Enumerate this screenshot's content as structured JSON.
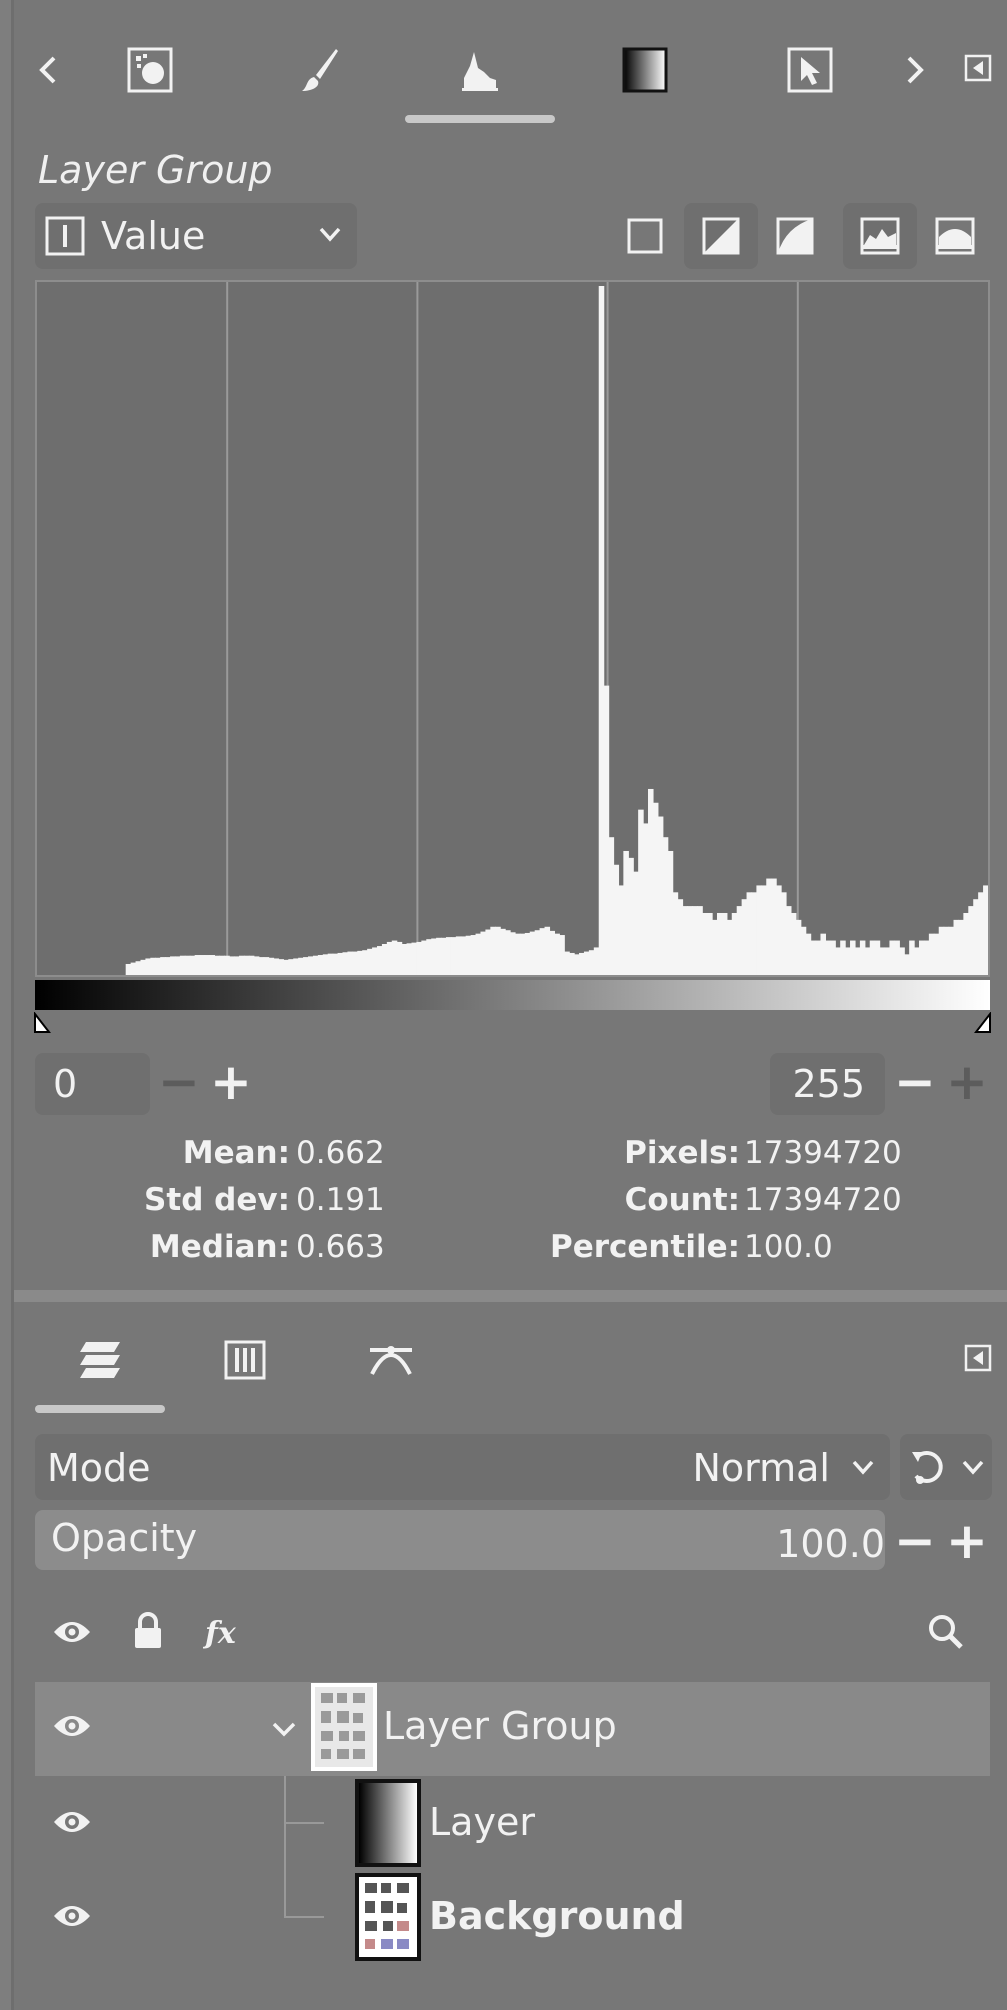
{
  "histogram_panel": {
    "title": "Layer Group",
    "channel": "Value",
    "range_low": "0",
    "range_high": "255",
    "minus": "−",
    "plus": "+",
    "stats": {
      "mean_label": "Mean:",
      "mean_value": "0.662",
      "stddev_label": "Std dev:",
      "stddev_value": "0.191",
      "median_label": "Median:",
      "median_value": "0.663",
      "pixels_label": "Pixels:",
      "pixels_value": "17394720",
      "count_label": "Count:",
      "count_value": "17394720",
      "percentile_label": "Percentile:",
      "percentile_value": "100.0"
    },
    "histogram_bins": [
      0,
      0,
      0,
      0,
      0,
      0,
      0,
      0,
      0,
      0,
      0,
      0,
      0,
      0,
      0,
      0,
      0,
      0,
      1.6,
      1.8,
      2.0,
      2.2,
      2.4,
      2.5,
      2.5,
      2.6,
      2.6,
      2.7,
      2.7,
      2.8,
      2.8,
      2.8,
      2.9,
      2.9,
      2.9,
      2.9,
      2.8,
      2.8,
      2.8,
      2.7,
      2.7,
      2.8,
      2.8,
      2.8,
      2.7,
      2.6,
      2.6,
      2.5,
      2.4,
      2.3,
      2.2,
      2.3,
      2.4,
      2.5,
      2.6,
      2.7,
      2.8,
      2.9,
      3.0,
      3.1,
      3.1,
      3.2,
      3.3,
      3.4,
      3.4,
      3.5,
      3.6,
      3.8,
      4.0,
      4.2,
      4.5,
      4.8,
      5.0,
      4.8,
      4.5,
      4.6,
      4.7,
      4.8,
      5.0,
      5.2,
      5.3,
      5.4,
      5.4,
      5.5,
      5.5,
      5.6,
      5.6,
      5.7,
      5.8,
      6.0,
      6.3,
      6.6,
      7.0,
      7.0,
      6.7,
      6.5,
      6.2,
      6.0,
      6.0,
      6.1,
      6.3,
      6.5,
      6.8,
      7.0,
      6.4,
      6.0,
      5.8,
      3.4,
      3.2,
      3.0,
      3.2,
      3.4,
      3.6,
      4.0,
      100,
      42,
      20,
      16,
      13,
      18,
      17,
      15,
      24,
      22,
      27,
      25,
      23,
      20,
      18,
      12,
      11,
      10,
      10,
      10,
      10,
      9,
      9,
      8,
      9,
      9,
      8,
      9,
      10,
      11,
      12,
      12,
      13,
      13,
      14,
      14,
      13,
      12,
      10,
      9,
      8,
      7,
      6,
      5,
      5,
      6,
      5,
      5,
      4,
      5,
      4,
      5,
      4,
      5,
      4,
      5,
      5,
      4,
      4,
      5,
      5,
      4,
      3,
      5,
      4,
      5,
      5,
      6,
      6,
      7,
      7,
      7,
      8,
      8,
      9,
      10,
      11,
      12,
      13
    ],
    "selected_layer_thumbnail_note": ""
  },
  "layers_panel": {
    "mode_label": "Mode",
    "mode_value": "Normal",
    "opacity_label": "Opacity",
    "opacity_value": "100.0",
    "layers": [
      {
        "name": "Layer Group",
        "selected": true,
        "bold": false
      },
      {
        "name": "Layer",
        "selected": false,
        "bold": false
      },
      {
        "name": "Background",
        "selected": false,
        "bold": true
      }
    ]
  },
  "colors": {
    "panel_bg": "#777777",
    "histogram_bg": "#6e6e6e",
    "histogram_fill": "#f5f5f5",
    "selected_row": "#898989"
  }
}
